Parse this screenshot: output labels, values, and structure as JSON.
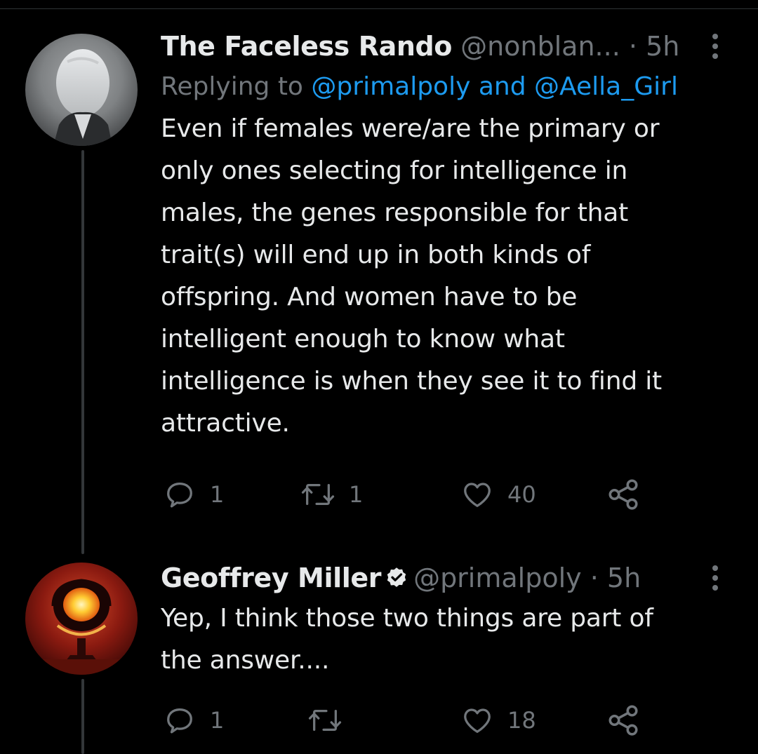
{
  "colors": {
    "background": "#000000",
    "text": "#e7e9ea",
    "muted": "#71767b",
    "link": "#1d9bf0",
    "divider": "#2f3336"
  },
  "tweets": [
    {
      "display_name": "The Faceless Rando",
      "handle": "@nonblan...",
      "separator": "·",
      "time": "5h",
      "replying_prefix": "Replying to",
      "replying_user1": "@primalpoly",
      "replying_and": "and",
      "replying_user2": "@Aella_Girl",
      "body": "Even if females were/are the primary or\nonly ones selecting for intelligence in\nmales, the genes responsible for that\ntrait(s) will end up in both kinds of\noffspring. And women have to be\nintelligent enough to know what\nintelligence is when they see it to find it\nattractive.",
      "reply_count": "1",
      "retweet_count": "1",
      "like_count": "40",
      "icons": [
        "reply-icon",
        "retweet-icon",
        "like-icon",
        "share-icon",
        "more-icon"
      ]
    },
    {
      "display_name": "Geoffrey Miller",
      "verified": true,
      "handle": "@primalpoly",
      "separator": "·",
      "time": "5h",
      "body": "Yep, I think those two things are part of\nthe answer....",
      "reply_count": "1",
      "retweet_count": "",
      "like_count": "18",
      "icons": [
        "reply-icon",
        "retweet-icon",
        "like-icon",
        "share-icon",
        "more-icon"
      ]
    }
  ]
}
